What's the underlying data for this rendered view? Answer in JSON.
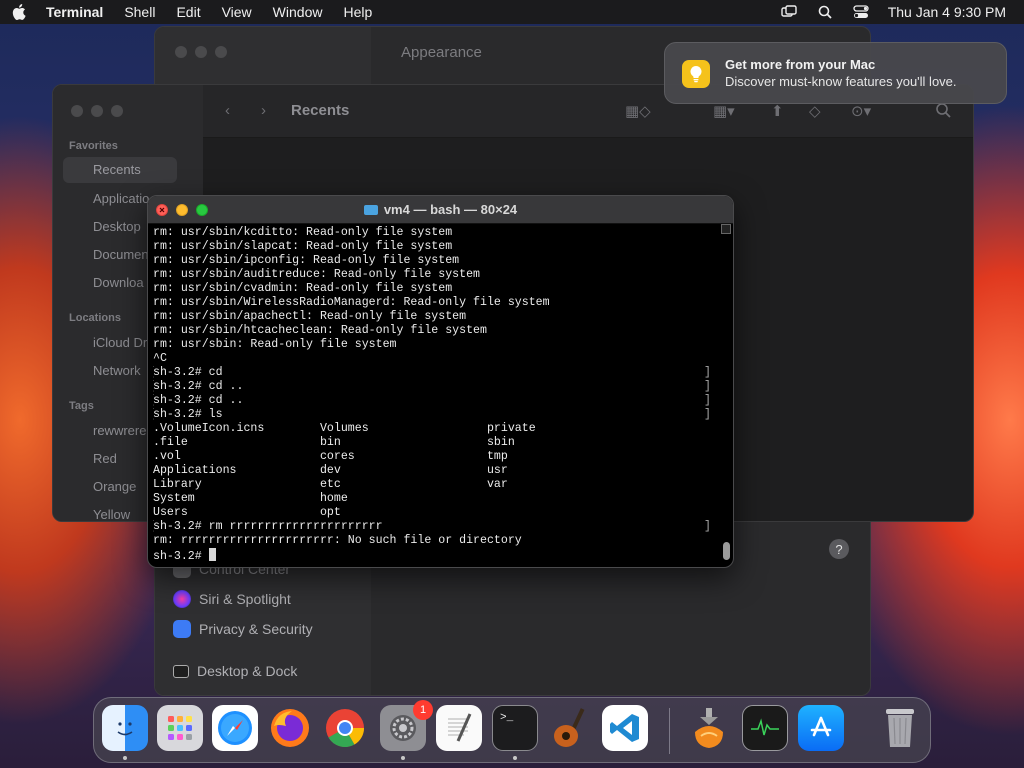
{
  "menubar": {
    "app": "Terminal",
    "items": [
      "Shell",
      "Edit",
      "View",
      "Window",
      "Help"
    ],
    "datetime": "Thu Jan 4  9:30 PM"
  },
  "settings_window": {
    "title": "Appearance",
    "sidebar": [
      "Control Center",
      "Siri & Spotlight",
      "Privacy & Security",
      "Desktop & Dock"
    ],
    "help": "?"
  },
  "finder_window": {
    "title": "Recents",
    "favorites_header": "Favorites",
    "favorites": [
      "Recents",
      "Applicatio",
      "Desktop",
      "Documen",
      "Downloa"
    ],
    "locations_header": "Locations",
    "locations": [
      "iCloud Dr",
      "Network"
    ],
    "tags_header": "Tags",
    "tags": [
      "rewwrere",
      "Red",
      "Orange",
      "Yellow"
    ]
  },
  "notification": {
    "title": "Get more from your Mac",
    "body": "Discover must-know features you'll love."
  },
  "terminal": {
    "title": "vm4 — bash — 80×24",
    "lines": [
      "rm: usr/sbin/kcditto: Read-only file system",
      "rm: usr/sbin/slapcat: Read-only file system",
      "rm: usr/sbin/ipconfig: Read-only file system",
      "rm: usr/sbin/auditreduce: Read-only file system",
      "rm: usr/sbin/cvadmin: Read-only file system",
      "rm: usr/sbin/WirelessRadioManagerd: Read-only file system",
      "rm: usr/sbin/apachectl: Read-only file system",
      "rm: usr/sbin/htcacheclean: Read-only file system",
      "rm: usr/sbin: Read-only file system",
      "^C",
      "sh-3.2# cd",
      "sh-3.2# cd ..",
      "sh-3.2# cd ..",
      "sh-3.2# ls",
      ".VolumeIcon.icns        Volumes                 private",
      ".file                   bin                     sbin",
      ".vol                    cores                   tmp",
      "Applications            dev                     usr",
      "Library                 etc                     var",
      "System                  home",
      "Users                   opt",
      "sh-3.2# rm rrrrrrrrrrrrrrrrrrrrrr",
      "rm: rrrrrrrrrrrrrrrrrrrrrr: No such file or directory",
      "sh-3.2# "
    ],
    "bracketed_lines": [
      10,
      11,
      12,
      13,
      21
    ]
  },
  "dock": {
    "apps": [
      "Finder",
      "Launchpad",
      "Safari",
      "Firefox",
      "Chrome",
      "System Settings",
      "TextEdit",
      "Terminal",
      "GarageBand",
      "Visual Studio Code",
      "Installer",
      "Activity Monitor",
      "App Store",
      "Trash"
    ],
    "settings_badge": "1"
  }
}
